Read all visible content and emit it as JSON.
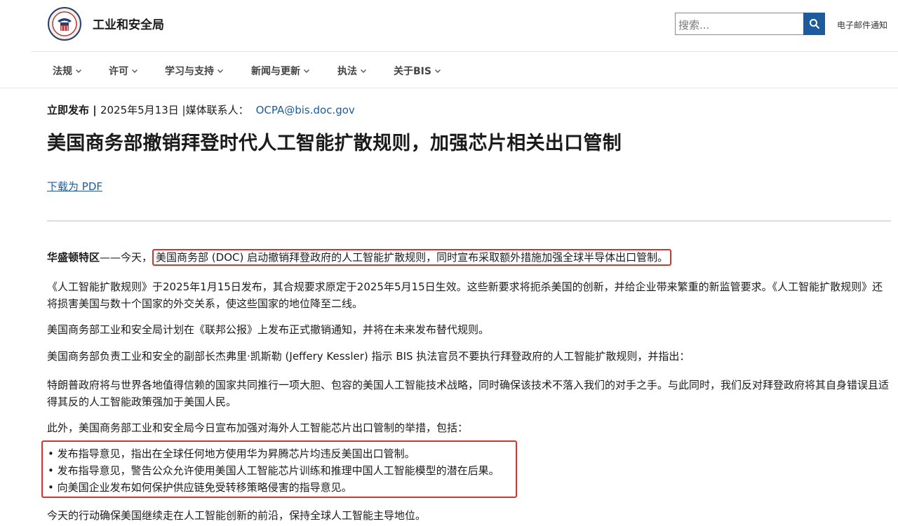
{
  "header": {
    "site_title": "工业和安全局",
    "search_placeholder": "搜索...",
    "email_link": "电子邮件通知",
    "logo_icon": "bis-seal-icon",
    "search_icon": "search-icon"
  },
  "nav": {
    "items": [
      {
        "label": "法规"
      },
      {
        "label": "许可"
      },
      {
        "label": "学习与支持"
      },
      {
        "label": "新闻与更新"
      },
      {
        "label": "执法"
      },
      {
        "label": "关于BIS"
      }
    ]
  },
  "article": {
    "release_label": "立即发布",
    "date": "2025年5月13日",
    "contact_label": "|媒体联系人：",
    "contact_email": "OCPA@bis.doc.gov",
    "headline": "美国商务部撤销拜登时代人工智能扩散规则，加强芯片相关出口管制",
    "pdf_link": "下载为 PDF",
    "dateline": "华盛顿特区",
    "p1_lead": "——今天，",
    "p1_highlight": "美国商务部 (DOC) 启动撤销拜登政府的人工智能扩散规则，同时宣布采取额外措施加强全球半导体出口管制。",
    "p2": "《人工智能扩散规则》于2025年1月15日发布，其合规要求原定于2025年5月15日生效。这些新要求将扼杀美国的创新，并给企业带来繁重的新监管要求。《人工智能扩散规则》还将损害美国与数十个国家的外交关系，使这些国家的地位降至二线。",
    "p3": "美国商务部工业和安全局计划在《联邦公报》上发布正式撤销通知，并将在未来发布替代规则。",
    "p4": "美国商务部负责工业和安全的副部长杰弗里·凯斯勒 (Jeffery Kessler) 指示 BIS 执法官员不要执行拜登政府的人工智能扩散规则，并指出：",
    "p5": "特朗普政府将与世界各地值得信赖的国家共同推行一项大胆、包容的美国人工智能技术战略，同时确保该技术不落入我们的对手之手。与此同时，我们反对拜登政府将其自身错误且适得其反的人工智能政策强加于美国人民。",
    "p6": "此外，美国商务部工业和安全局今日宣布加强对海外人工智能芯片出口管制的举措，包括：",
    "bullets": [
      "• 发布指导意见，指出在全球任何地方使用华为昇腾芯片均违反美国出口管制。",
      "• 发布指导意见，警告公众允许使用美国人工智能芯片训练和推理中国人工智能模型的潜在后果。",
      "• 向美国企业发布如何保护供应链免受转移策略侵害的指导意见。"
    ],
    "p7": "今天的行动确保美国继续走在人工智能创新的前沿，保持全球人工智能主导地位。"
  },
  "colors": {
    "link": "#1e5b9c",
    "highlight_border": "#d9342b",
    "search_button": "#1e5b9c"
  }
}
